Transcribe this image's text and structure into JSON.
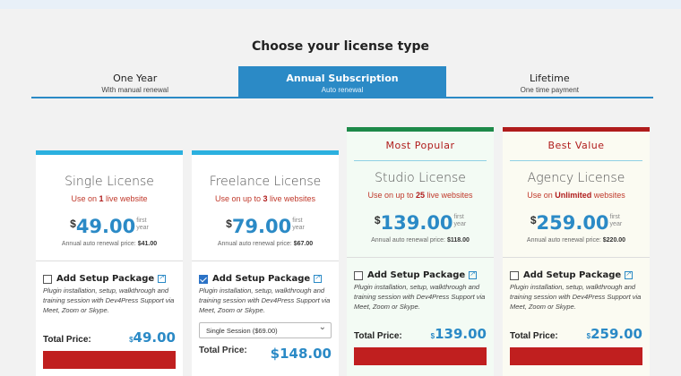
{
  "heading": "Choose your license type",
  "tabs": [
    {
      "label": "One Year",
      "sub": "With manual renewal"
    },
    {
      "label": "Annual Subscription",
      "sub": "Auto renewal"
    },
    {
      "label": "Lifetime",
      "sub": "One time payment"
    }
  ],
  "cards": [
    {
      "title": "Single License",
      "uses_prefix": "Use on ",
      "uses_bold": "1",
      "uses_suffix": " live website",
      "price": "49.00",
      "currency": "$",
      "per_top": "first",
      "per_bottom": "year",
      "renew_label": "Annual auto renewal price: ",
      "renew_price": "$41.00",
      "setup_label": "Add Setup Package",
      "setup_checked": false,
      "setup_desc": "Plugin installation, setup, walkthrough and training session with Dev4Press Support via Meet, Zoom or Skype.",
      "total_label": "Total Price:",
      "total_currency": "$",
      "total_value": "49.00",
      "bar_color": "#2bb0df"
    },
    {
      "title": "Freelance License",
      "uses_prefix": "Use on up to ",
      "uses_bold": "3",
      "uses_suffix": " live websites",
      "price": "79.00",
      "currency": "$",
      "per_top": "first",
      "per_bottom": "year",
      "renew_label": "Annual auto renewal price: ",
      "renew_price": "$67.00",
      "setup_label": "Add Setup Package",
      "setup_checked": true,
      "setup_desc": "Plugin installation, setup, walkthrough and training session with Dev4Press Support via Meet, Zoom or Skype.",
      "select_value": "Single Session ($69.00)",
      "total_label": "Total Price:",
      "total_value": "$148.00",
      "bar_color": "#2bb0df"
    },
    {
      "ribbon": "Most Popular",
      "title": "Studio License",
      "uses_prefix": "Use on up to ",
      "uses_bold": "25",
      "uses_suffix": " live websites",
      "price": "139.00",
      "currency": "$",
      "per_top": "first",
      "per_bottom": "year",
      "renew_label": "Annual auto renewal price: ",
      "renew_price": "$118.00",
      "setup_label": "Add Setup Package",
      "setup_checked": false,
      "setup_desc": "Plugin installation, setup, walkthrough and training session with Dev4Press Support via Meet, Zoom or Skype.",
      "total_label": "Total Price:",
      "total_currency": "$",
      "total_value": "139.00",
      "bar_color": "#1e8a4a"
    },
    {
      "ribbon": "Best Value",
      "title": "Agency License",
      "uses_prefix": "Use on ",
      "uses_bold": "Unlimited",
      "uses_suffix": " websites",
      "price": "259.00",
      "currency": "$",
      "per_top": "first",
      "per_bottom": "year",
      "renew_label": "Annual auto renewal price: ",
      "renew_price": "$220.00",
      "setup_label": "Add Setup Package",
      "setup_checked": false,
      "setup_desc": "Plugin installation, setup, walkthrough and training session with Dev4Press Support via Meet, Zoom or Skype.",
      "total_label": "Total Price:",
      "total_currency": "$",
      "total_value": "259.00",
      "bar_color": "#b01c1c"
    }
  ],
  "colors": {
    "accent": "#2b8ac6",
    "buy": "#c01f1f",
    "red_text": "#c0392b"
  }
}
